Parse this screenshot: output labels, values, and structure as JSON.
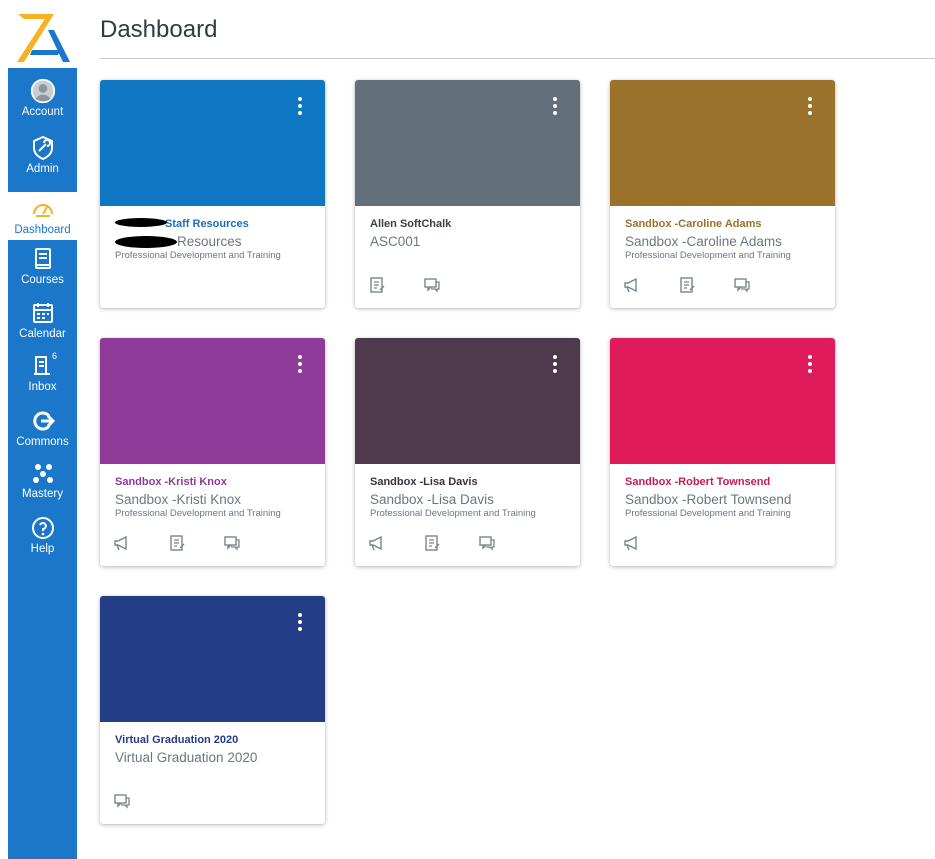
{
  "header": {
    "title": "Dashboard"
  },
  "nav": [
    {
      "label": "Account",
      "icon": "account-icon"
    },
    {
      "label": "Admin",
      "icon": "admin-icon"
    },
    {
      "label": "Dashboard",
      "icon": "dashboard-icon",
      "active": true
    },
    {
      "label": "Courses",
      "icon": "courses-icon"
    },
    {
      "label": "Calendar",
      "icon": "calendar-icon"
    },
    {
      "label": "Inbox",
      "icon": "inbox-icon",
      "badge": "6"
    },
    {
      "label": "Commons",
      "icon": "commons-icon"
    },
    {
      "label": "Mastery",
      "icon": "mastery-icon"
    },
    {
      "label": "Help",
      "icon": "help-icon"
    }
  ],
  "colors": {
    "sidebar": "#1a77c9",
    "logo_yellow": "#f5b323",
    "logo_blue": "#1a77c9"
  },
  "cards": [
    {
      "name": "Staff Resources",
      "code": "Resources",
      "term": "Professional Development and Training",
      "color": "#0e77c3",
      "name_color": "#1a6fbf",
      "actions": []
    },
    {
      "name": "Allen SoftChalk",
      "code": "ASC001",
      "term": "",
      "color": "#63707c",
      "name_color": "#3b4147",
      "actions": [
        "assignments-icon",
        "discussions-icon"
      ]
    },
    {
      "name": "Sandbox -Caroline Adams",
      "code": "Sandbox -Caroline Adams",
      "term": "Professional Development and Training",
      "color": "#9a722c",
      "name_color": "#9a722c",
      "actions": [
        "announcements-icon",
        "assignments-icon",
        "discussions-icon"
      ]
    },
    {
      "name": "Sandbox -Kristi Knox",
      "code": "Sandbox -Kristi Knox",
      "term": "Professional Development and Training",
      "color": "#8e3a98",
      "name_color": "#8e3a98",
      "actions": [
        "announcements-icon",
        "assignments-icon",
        "discussions-icon"
      ]
    },
    {
      "name": "Sandbox -Lisa Davis",
      "code": "Sandbox -Lisa Davis",
      "term": "Professional Development and Training",
      "color": "#4e3a4c",
      "name_color": "#3b3040",
      "actions": [
        "announcements-icon",
        "assignments-icon",
        "discussions-icon"
      ]
    },
    {
      "name": "Sandbox -Robert Townsend",
      "code": "Sandbox -Robert Townsend",
      "term": "Professional Development and Training",
      "color": "#e01b5c",
      "name_color": "#c81a55",
      "actions": [
        "announcements-icon"
      ]
    },
    {
      "name": "Virtual Graduation 2020",
      "code": "Virtual Graduation 2020",
      "term": "",
      "color": "#233d87",
      "name_color": "#233d87",
      "actions": [
        "discussions-icon"
      ]
    }
  ]
}
